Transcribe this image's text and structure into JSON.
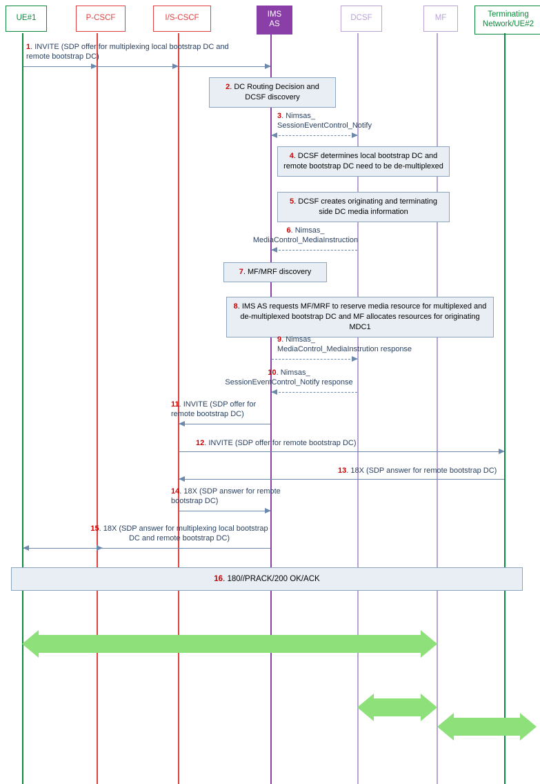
{
  "participants": {
    "ue1": "UE#1",
    "pcscf": "P-CSCF",
    "iscscf": "I/S-CSCF",
    "imsas": "IMS\nAS",
    "dcsf": "DCSF",
    "mf": "MF",
    "term": "Terminating\nNetwork/UE#2"
  },
  "steps": {
    "s1n": "1",
    "s1": ". INVITE (SDP offer for multiplexing local bootstrap DC and remote bootstrap DC)",
    "s2n": "2",
    "s2": ". DC Routing Decision and DCSF discovery",
    "s3n": "3",
    "s3": ". Nimsas_\nSessionEventControl_Notify",
    "s4n": "4",
    "s4": ". DCSF determines local bootstrap DC and remote bootstrap DC need to be de-multiplexed",
    "s5n": "5",
    "s5": ". DCSF creates originating and terminating side DC media information",
    "s6n": "6",
    "s6": ". Nimsas_\nMediaControl_MediaInstruction",
    "s7n": "7",
    "s7": ". MF/MRF discovery",
    "s8n": "8",
    "s8": ". IMS AS requests MF/MRF to reserve media resource for multiplexed and de-multiplexed bootstrap DC and MF allocates resources for originating MDC1",
    "s9n": "9",
    "s9": ". Nimsas_\nMediaControl_MediaInstrution response",
    "s10n": "10",
    "s10": ". Nimsas_\nSessionEventControl_Notify response",
    "s11n": "11",
    "s11": ". INVITE (SDP offer for remote bootstrap DC)",
    "s12n": "12",
    "s12": ". INVITE (SDP offer for remote bootstrap DC)",
    "s13n": "13",
    "s13": ". 18X (SDP answer for remote bootstrap DC)",
    "s14n": "14",
    "s14": ". 18X (SDP answer for remote bootstrap DC)",
    "s15n": "15",
    "s15": ". 18X (SDP answer for multiplexing local bootstrap DC and remote bootstrap DC)",
    "s16n": "16",
    "s16": ". 180//PRACK/200 OK/ACK"
  }
}
